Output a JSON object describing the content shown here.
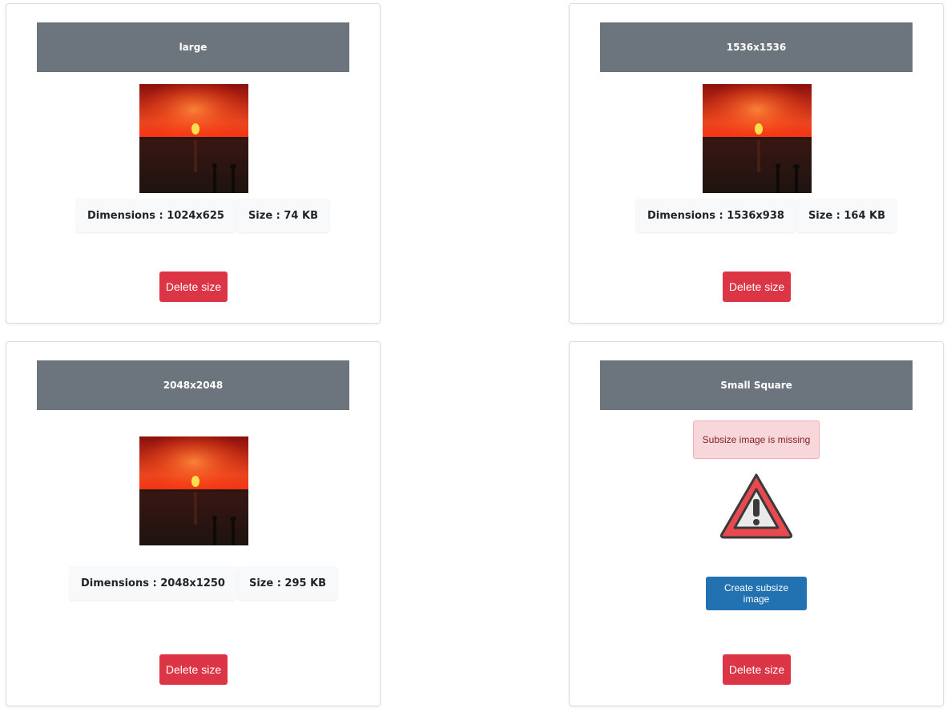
{
  "colors": {
    "header_bg": "#6c757d",
    "delete_button": "#dc3545",
    "create_button": "#2271b1",
    "alert_bg": "#f8d7da",
    "alert_text": "#842029"
  },
  "cards": [
    {
      "title": "large",
      "dimensions": "Dimensions : 1024x625",
      "size": "Size : 74 KB",
      "delete_label": "Delete size"
    },
    {
      "title": "1536x1536",
      "dimensions": "Dimensions : 1536x938",
      "size": "Size : 164 KB",
      "delete_label": "Delete size"
    },
    {
      "title": "2048x2048",
      "dimensions": "Dimensions : 2048x1250",
      "size": "Size : 295 KB",
      "delete_label": "Delete size"
    },
    {
      "title": "Small Square",
      "alert": "Subsize image is missing",
      "icon": "warning-triangle-icon",
      "create_label": "Create subsize image",
      "delete_label": "Delete size"
    }
  ]
}
